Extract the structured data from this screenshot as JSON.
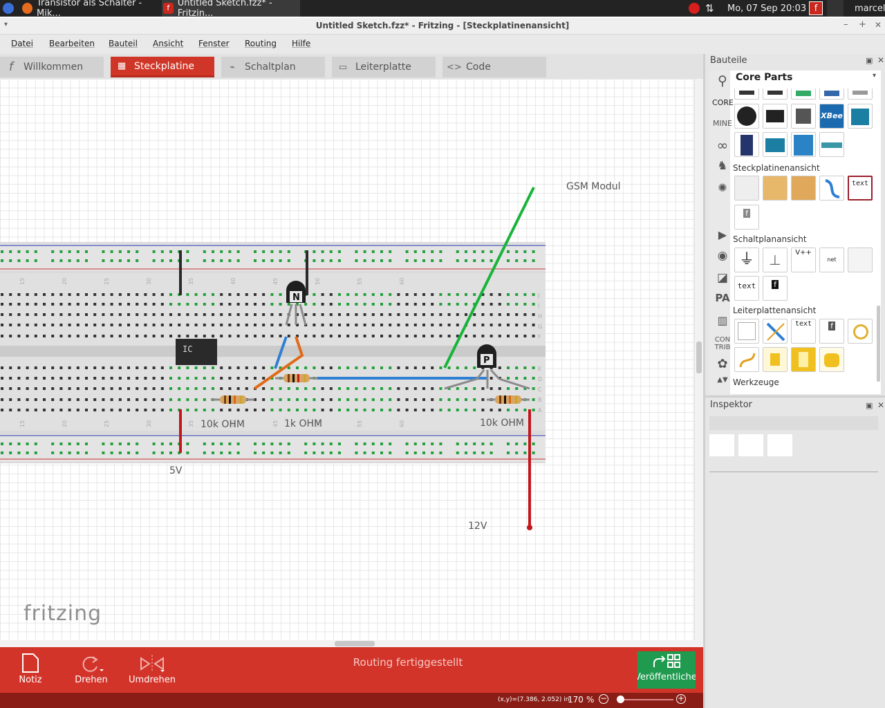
{
  "taskbar": {
    "window1": "Transistor als Schalter - Mik...",
    "window2": "Untitled Sketch.fzz* - Fritzin...",
    "datetime": "Mo, 07 Sep  20:03",
    "user": "marcel"
  },
  "window": {
    "title": "Untitled Sketch.fzz* - Fritzing - [Steckplatinenansicht]",
    "min": "–",
    "max": "+",
    "close": "✕"
  },
  "menu": [
    "Datei",
    "Bearbeiten",
    "Bauteil",
    "Ansicht",
    "Fenster",
    "Routing",
    "Hilfe"
  ],
  "tabs": [
    {
      "label": "Willkommen",
      "icon": "f"
    },
    {
      "label": "Steckplatine",
      "icon": "▦"
    },
    {
      "label": "Schaltplan",
      "icon": "⌁"
    },
    {
      "label": "Leiterplatte",
      "icon": "▭"
    },
    {
      "label": "Code",
      "icon": "<>"
    }
  ],
  "canvas": {
    "labels": {
      "gsm": "GSM Modul",
      "r1": "10k OHM",
      "r2": "1k OHM",
      "r3": "10k OHM",
      "v5": "5V",
      "v12": "12V",
      "ic": "IC",
      "npn": "N",
      "pnp": "P",
      "logo": "fritzing"
    },
    "colnums": [
      "15",
      "20",
      "25",
      "30",
      "35",
      "40",
      "45",
      "50",
      "55",
      "60"
    ],
    "rowletters_top": [
      "J",
      "I",
      "H",
      "G",
      "F"
    ],
    "rowletters_bot": [
      "E",
      "D",
      "C",
      "B",
      "A"
    ],
    "colors": {
      "red": "#c3161c",
      "black": "#2a2a2a",
      "blue": "#2f7fd3",
      "orange": "#e06a18",
      "green": "#18b43a",
      "gray": "#8a8a8a"
    }
  },
  "bottom": {
    "note": "Notiz",
    "rotate": "Drehen",
    "flip": "Umdrehen",
    "status": "Routing fertiggestellt",
    "publish": "Veröffentlichen"
  },
  "statusbar": {
    "coords": "(x,y)=(7.386, 2.052) in",
    "zoom": "170",
    "zoom_unit": "%"
  },
  "parts": {
    "title": "Bauteile",
    "bin": "Core Parts",
    "side": [
      "CORE",
      "MINE",
      "CON TRIB"
    ],
    "sections": {
      "bb": "Steckplatinenansicht",
      "sch": "Schaltplanansicht",
      "pcb": "Leiterplattenansicht",
      "tools": "Werkzeuge"
    },
    "tile_texts": {
      "xbee": "XBee",
      "text": "text",
      "vcc": "V++",
      "netlabel": "net label",
      "f": "f"
    }
  },
  "inspector": {
    "title": "Inspektor"
  }
}
